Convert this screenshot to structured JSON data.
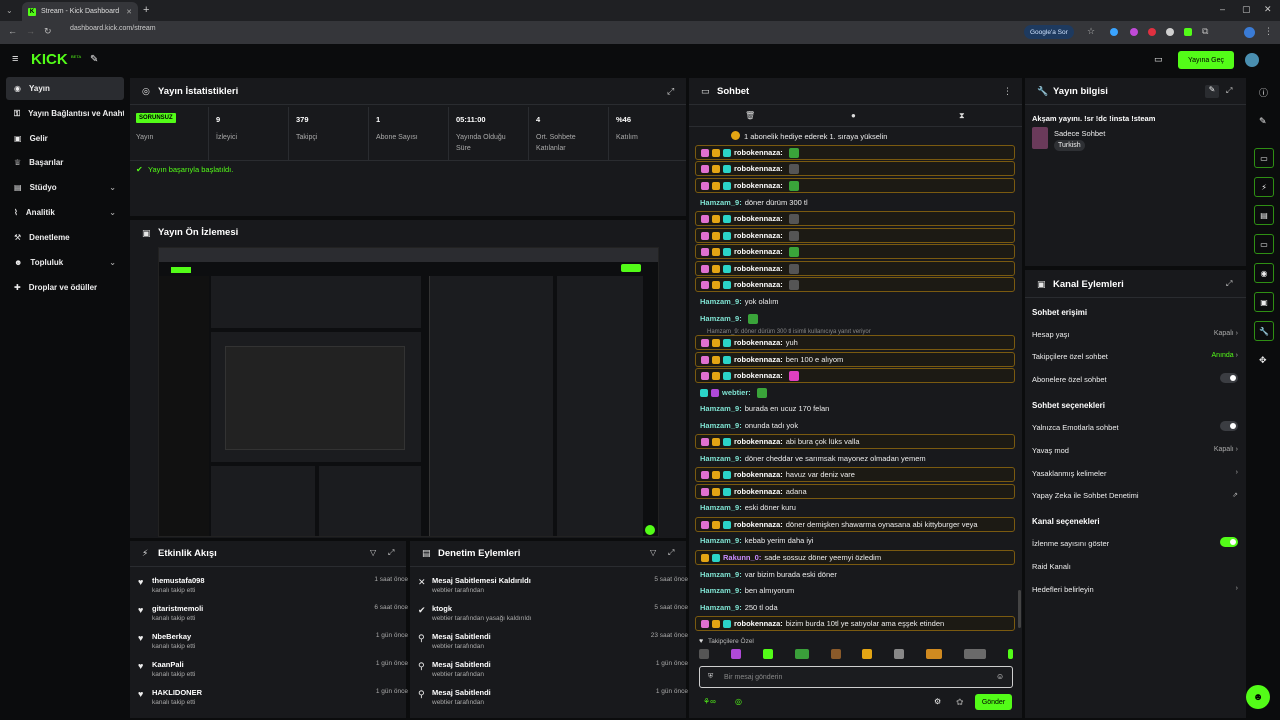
{
  "browser": {
    "tab_title": "Stream - Kick Dashboard",
    "url": "dashboard.kick.com/stream",
    "google_chip": "Google'a Sor"
  },
  "appbar": {
    "logo": "KICK",
    "logo_badge": "BETA",
    "go_live_label": "Yayına Geç"
  },
  "sidebar": {
    "items": [
      {
        "label": "Yayın",
        "icon": "broadcast-icon"
      },
      {
        "label": "Yayın Bağlantısı ve Anahtarı",
        "icon": "key-icon"
      },
      {
        "label": "Gelir",
        "icon": "money-icon"
      },
      {
        "label": "Başarılar",
        "icon": "trophy-icon"
      },
      {
        "label": "Stüdyo",
        "icon": "studio-icon"
      },
      {
        "label": "Analitik",
        "icon": "chart-icon"
      },
      {
        "label": "Denetleme",
        "icon": "hammer-icon"
      },
      {
        "label": "Topluluk",
        "icon": "community-icon"
      },
      {
        "label": "Droplar ve ödüller",
        "icon": "gift-icon"
      }
    ]
  },
  "stats": {
    "title": "Yayın İstatistikleri",
    "badge": "SORUNSUZ",
    "stream_label": "Yayın",
    "cells": [
      {
        "value": "9",
        "label": "İzleyici"
      },
      {
        "value": "379",
        "label": "Takipçi"
      },
      {
        "value": "1",
        "label": "Abone Sayısı"
      },
      {
        "value": "05:11:00",
        "label": "Yayında Olduğu Süre"
      },
      {
        "value": "4",
        "label": "Ort. Sohbete Katılanlar"
      },
      {
        "value": "%46",
        "label": "Katılım"
      }
    ],
    "success_text": "Yayın başarıyla başlatıldı."
  },
  "preview": {
    "title": "Yayın Ön İzlemesi"
  },
  "activity": {
    "title": "Etkinlik Akışı",
    "rows": [
      {
        "name": "themustafa098",
        "sub": "kanalı takip etti",
        "time": "1 saat önce"
      },
      {
        "name": "gitaristmemoli",
        "sub": "kanalı takip etti",
        "time": "6 saat önce"
      },
      {
        "name": "NbeBerkay",
        "sub": "kanalı takip etti",
        "time": "1 gün önce"
      },
      {
        "name": "KaanPali",
        "sub": "kanalı takip etti",
        "time": "1 gün önce"
      },
      {
        "name": "HAKLIDONER",
        "sub": "kanalı takip etti",
        "time": "1 gün önce"
      }
    ]
  },
  "moderation": {
    "title": "Denetim Eylemleri",
    "rows": [
      {
        "name": "Mesaj Sabitlemesi Kaldırıldı",
        "sub": "webtier tarafından",
        "time": "5 saat önce"
      },
      {
        "name": "ktogk",
        "sub": "webtier tarafından yasağı kaldırıldı",
        "time": "5 saat önce"
      },
      {
        "name": "Mesaj Sabitlendi",
        "sub": "webtier tarafından",
        "time": "23 saat önce"
      },
      {
        "name": "Mesaj Sabitlendi",
        "sub": "webtier tarafından",
        "time": "1 gün önce"
      },
      {
        "name": "Mesaj Sabitlendi",
        "sub": "webtier tarafından",
        "time": "1 gün önce"
      }
    ]
  },
  "chat": {
    "title": "Sohbet",
    "gift_banner": "1 abonelik hediye ederek 1. sıraya yükselin",
    "messages": [
      {
        "user": "robokennaza:",
        "text": "",
        "color": "#ffffff",
        "hl": true
      },
      {
        "user": "robokennaza:",
        "text": "",
        "color": "#ffffff",
        "hl": true
      },
      {
        "user": "robokennaza:",
        "text": "",
        "color": "#ffffff",
        "hl": true
      },
      {
        "user": "Hamzam_9:",
        "text": "döner dürüm 300 tl",
        "color": "#7fe3d2",
        "hl": false
      },
      {
        "user": "robokennaza:",
        "text": "",
        "color": "#ffffff",
        "hl": true
      },
      {
        "user": "robokennaza:",
        "text": "",
        "color": "#ffffff",
        "hl": true
      },
      {
        "user": "robokennaza:",
        "text": "",
        "color": "#ffffff",
        "hl": true
      },
      {
        "user": "robokennaza:",
        "text": "",
        "color": "#ffffff",
        "hl": true
      },
      {
        "user": "robokennaza:",
        "text": "",
        "color": "#ffffff",
        "hl": true
      },
      {
        "user": "Hamzam_9:",
        "text": "yok olalım",
        "color": "#7fe3d2",
        "hl": false
      },
      {
        "user": "Hamzam_9:",
        "text": "",
        "color": "#7fe3d2",
        "hl": false
      },
      {
        "user": "robokennaza:",
        "text": "yuh",
        "color": "#ffffff",
        "hl": true
      },
      {
        "user": "robokennaza:",
        "text": "ben 100 e alıyom",
        "color": "#ffffff",
        "hl": true
      },
      {
        "user": "robokennaza:",
        "text": "",
        "color": "#ffffff",
        "hl": true
      },
      {
        "user": "webtier:",
        "text": "",
        "color": "#7fe3d2",
        "hl": false
      },
      {
        "user": "Hamzam_9:",
        "text": "burada en ucuz 170 felan",
        "color": "#7fe3d2",
        "hl": false
      },
      {
        "user": "Hamzam_9:",
        "text": "onunda tadı yok",
        "color": "#7fe3d2",
        "hl": false
      },
      {
        "user": "robokennaza:",
        "text": "abi bura çok lüks valla",
        "color": "#ffffff",
        "hl": true
      },
      {
        "user": "Hamzam_9:",
        "text": "döner cheddar ve sarımsak mayonez olmadan yemem",
        "color": "#7fe3d2",
        "hl": false
      },
      {
        "user": "robokennaza:",
        "text": "havuz var deniz vare",
        "color": "#ffffff",
        "hl": true
      },
      {
        "user": "robokennaza:",
        "text": "adana",
        "color": "#ffffff",
        "hl": true
      },
      {
        "user": "Hamzam_9:",
        "text": "eski döner kuru",
        "color": "#7fe3d2",
        "hl": false
      },
      {
        "user": "robokennaza:",
        "text": "döner demişken shawarma oynasana abi kittyburger veya",
        "color": "#ffffff",
        "hl": true
      },
      {
        "user": "Hamzam_9:",
        "text": "kebab yerim daha iyi",
        "color": "#7fe3d2",
        "hl": false
      },
      {
        "user": "Rakunn_0:",
        "text": "sade sossuz döner yeemyi özledim",
        "color": "#c98cff",
        "hl": true
      },
      {
        "user": "Hamzam_9:",
        "text": "var bizim burada eski döner",
        "color": "#7fe3d2",
        "hl": false
      },
      {
        "user": "Hamzam_9:",
        "text": "ben almıyorum",
        "color": "#7fe3d2",
        "hl": false
      },
      {
        "user": "Hamzam_9:",
        "text": "250 tl oda",
        "color": "#7fe3d2",
        "hl": false
      },
      {
        "user": "robokennaza:",
        "text": "bizim burda 10tl ye satıyolar ama eşşek etinden",
        "color": "#ffffff",
        "hl": true
      }
    ],
    "reply_note": "Hamzam_9: döner dürüm 300 tl isimli kullanıcıya yanıt veriyor",
    "followers_only": "Takipçilere Özel",
    "input_placeholder": "Bir mesaj gönderin",
    "send_label": "Gönder"
  },
  "stream_info": {
    "title": "Yayın bilgisi",
    "stream_title": "Akşam yayını. !sr !dc !insta !steam",
    "category": "Sadece Sohbet",
    "language": "Turkish"
  },
  "channel_actions": {
    "title": "Kanal Eylemleri",
    "chat_access_heading": "Sohbet erişimi",
    "account_age": {
      "label": "Hesap yaşı",
      "value": "Kapalı"
    },
    "followers_only": {
      "label": "Takipçilere özel sohbet",
      "value": "Anında"
    },
    "subscribers_only": {
      "label": "Abonelere özel sohbet"
    },
    "chat_options_heading": "Sohbet seçenekleri",
    "emotes_only": {
      "label": "Yalnızca Emotlarla sohbet"
    },
    "slow_mode": {
      "label": "Yavaş mod",
      "value": "Kapalı"
    },
    "banned_words": {
      "label": "Yasaklanmış kelimeler"
    },
    "ai_moderation": {
      "label": "Yapay Zeka ile Sohbet Denetimi"
    },
    "channel_options_heading": "Kanal seçenekleri",
    "show_viewers": {
      "label": "İzlenme sayısını göster",
      "on": true
    },
    "raid": {
      "label": "Raid Kanalı"
    },
    "goals": {
      "label": "Hedefleri belirleyin"
    }
  },
  "colors": {
    "accent": "#53fc18",
    "panel": "#18191c",
    "background": "#0b0c0d"
  }
}
